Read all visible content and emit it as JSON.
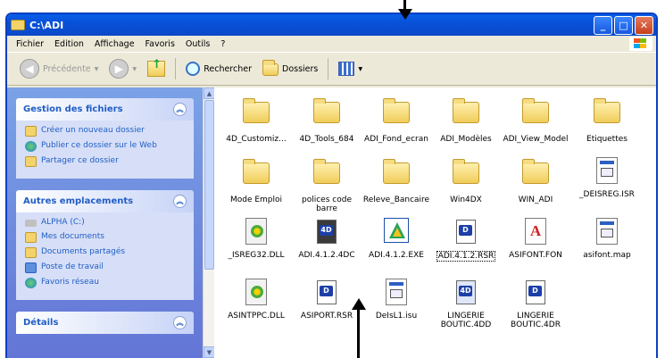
{
  "window": {
    "title": "C:\\ADI"
  },
  "title_buttons": {
    "minimize": "_",
    "maximize": "□",
    "close": "✕"
  },
  "menu": [
    "Fichier",
    "Edition",
    "Affichage",
    "Favoris",
    "Outils",
    "?"
  ],
  "toolbar": {
    "back_label": "Précédente",
    "search_label": "Rechercher",
    "folders_label": "Dossiers"
  },
  "tasks_panel": {
    "title": "Gestion des fichiers",
    "items": [
      "Créer un nouveau dossier",
      "Publier ce dossier sur le Web",
      "Partager ce dossier"
    ]
  },
  "places_panel": {
    "title": "Autres emplacements",
    "items": [
      "ALPHA (C:)",
      "Mes documents",
      "Documents partagés",
      "Poste de travail",
      "Favoris réseau"
    ]
  },
  "details_panel": {
    "title": "Détails"
  },
  "files": [
    {
      "name": "4D_Customiz...",
      "icon": "folder-icon"
    },
    {
      "name": "4D_Tools_684",
      "icon": "folder-icon"
    },
    {
      "name": "ADI_Fond_ecran",
      "icon": "folder-icon"
    },
    {
      "name": "ADI_Modèles",
      "icon": "folder-icon"
    },
    {
      "name": "ADI_View_Model",
      "icon": "folder-icon"
    },
    {
      "name": "Etiquettes",
      "icon": "folder-icon"
    },
    {
      "name": "Mode Emploi",
      "icon": "folder-icon"
    },
    {
      "name": "polices code barre",
      "icon": "folder-icon"
    },
    {
      "name": "Releve_Bancaire",
      "icon": "folder-icon"
    },
    {
      "name": "Win4DX",
      "icon": "folder-icon"
    },
    {
      "name": "WIN_ADI",
      "icon": "folder-icon"
    },
    {
      "name": "_DEISREG.ISR",
      "icon": "doc-icon"
    },
    {
      "name": "_ISREG32.DLL",
      "icon": "dll-icon"
    },
    {
      "name": "ADI.4.1.2.4DC",
      "icon": "4d-component-icon"
    },
    {
      "name": "ADI.4.1.2.EXE",
      "icon": "exe-icon"
    },
    {
      "name": "ADI.4.1.2.RSR",
      "icon": "4d-resource-icon"
    },
    {
      "name": "ASIFONT.FON",
      "icon": "font-icon"
    },
    {
      "name": "asifont.map",
      "icon": "doc-icon"
    },
    {
      "name": "ASINTPPC.DLL",
      "icon": "dll-icon"
    },
    {
      "name": "ASIPORT.RSR",
      "icon": "4d-resource-icon"
    },
    {
      "name": "DeIsL1.isu",
      "icon": "doc-icon"
    },
    {
      "name": "LINGERIE BOUTIC.4DD",
      "icon": "4d-data-icon"
    },
    {
      "name": "LINGERIE BOUTIC.4DR",
      "icon": "4d-resource-icon"
    }
  ]
}
